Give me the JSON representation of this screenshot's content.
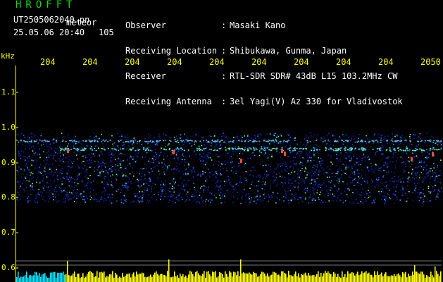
{
  "header": {
    "brand": "HROFFT",
    "file_name": "UT2505062040.pn",
    "meteor_label": "meteor",
    "date_time": "25.05.06 20:40",
    "meteor_count": "105"
  },
  "info": {
    "rows": [
      {
        "label": "Observer",
        "value": "Masaki Kano"
      },
      {
        "label": "Receiving Location",
        "value": "Shibukawa, Gunma, Japan"
      },
      {
        "label": "Receiver",
        "value": "RTL-SDR SDR# 43dB L15 103.2MHz CW"
      },
      {
        "label": "Receiving Antenna",
        "value": "3el Yagi(V) Az 330 for Vladivostok"
      }
    ],
    "separator": ":"
  },
  "axes": {
    "y_unit": "kHz",
    "y_ticks": [
      "1.1",
      "1.0",
      "0.9",
      "0.8",
      "0.7",
      "0.6"
    ],
    "x_ticks": [
      "204",
      "204",
      "204",
      "204",
      "204",
      "204",
      "204",
      "204",
      "204",
      "2050"
    ]
  },
  "colors": {
    "brand": "#00e000",
    "axis": "#ffff00",
    "text": "#ffffff",
    "echo_band": "#2244ff",
    "echo_hot": "#ff5030",
    "histogram_cyan": "#00e5ff",
    "histogram_yellow": "#ffff00"
  }
}
